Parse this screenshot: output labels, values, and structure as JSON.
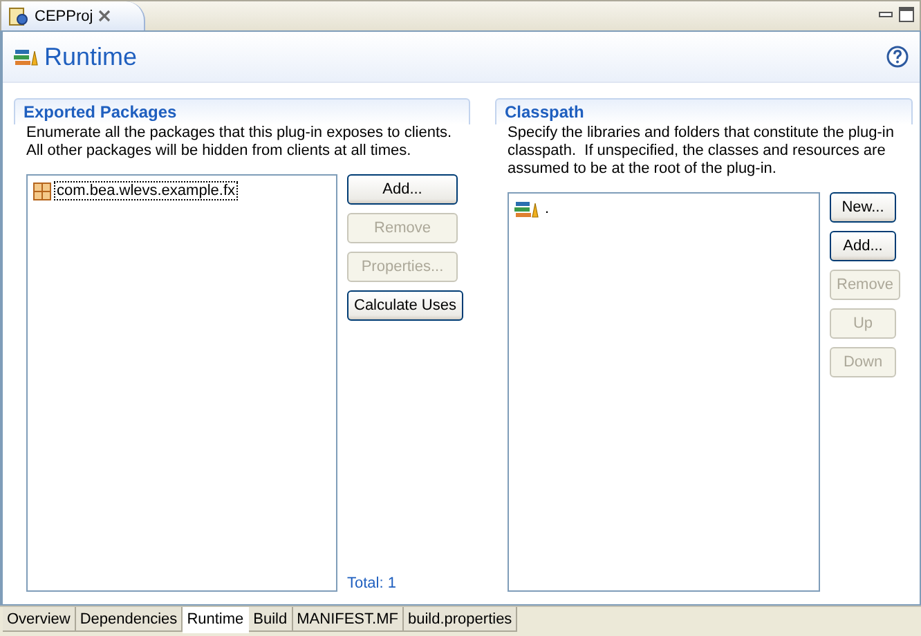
{
  "editor_tab": {
    "title": "CEPProj"
  },
  "page": {
    "title": "Runtime"
  },
  "sections": [
    {
      "kind": "exported",
      "title": "Exported Packages",
      "description": "Enumerate all the packages that this plug-in exposes to clients. All other packages will be hidden from clients at all times.",
      "items": [
        {
          "label": "com.bea.wlevs.example.fx",
          "selected": true
        }
      ],
      "buttons": [
        {
          "label": "Add...",
          "disabled": false
        },
        {
          "label": "Remove",
          "disabled": true
        },
        {
          "label": "Properties...",
          "disabled": true
        },
        {
          "label": "Calculate Uses",
          "disabled": false
        }
      ],
      "total": "Total: 1"
    },
    {
      "kind": "classpath",
      "title": "Classpath",
      "description": "Specify the libraries and folders that constitute the plug-in classpath.  If unspecified, the classes and resources are assumed to be at the root of the plug-in.",
      "items": [
        {
          "label": ".",
          "selected": false
        }
      ],
      "buttons": [
        {
          "label": "New...",
          "disabled": false
        },
        {
          "label": "Add...",
          "disabled": false
        },
        {
          "label": "Remove",
          "disabled": true
        },
        {
          "label": "Up",
          "disabled": true
        },
        {
          "label": "Down",
          "disabled": true
        }
      ]
    }
  ],
  "bottom_tabs": [
    {
      "label": "Overview",
      "selected": false
    },
    {
      "label": "Dependencies",
      "selected": false
    },
    {
      "label": "Runtime",
      "selected": true
    },
    {
      "label": "Build",
      "selected": false
    },
    {
      "label": "MANIFEST.MF",
      "selected": false
    },
    {
      "label": "build.properties",
      "selected": false
    }
  ]
}
